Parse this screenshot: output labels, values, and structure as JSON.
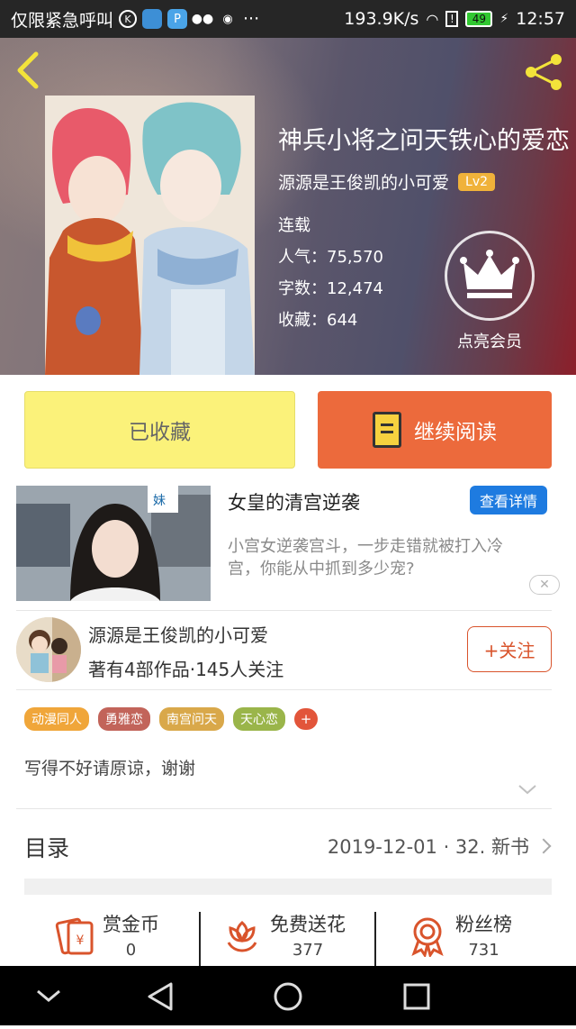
{
  "status_bar": {
    "carrier_text": "仅限紧急呼叫",
    "network_speed": "193.9K/s",
    "battery": "49",
    "time": "12:57",
    "more": "···"
  },
  "book": {
    "title": "神兵小将之问天铁心的爱恋",
    "author": "源源是王俊凯的小可爱",
    "level": "Lv2",
    "status": "连载",
    "popularity": "人气：75,570",
    "word_count": "字数：12,474",
    "favorites": "收藏：644",
    "vip_label": "点亮会员"
  },
  "actions": {
    "collected_label": "已收藏",
    "continue_label": "继续阅读"
  },
  "ad": {
    "title": "女皇的清宫逆袭",
    "detail_button": "查看详情",
    "description": "小宫女逆袭宫斗，一步走错就被打入冷宫，你能从中抓到多少宠?",
    "close": "✕",
    "sign_text": "妹"
  },
  "author_panel": {
    "name": "源源是王俊凯的小可爱",
    "stats": "著有4部作品·145人关注",
    "follow_label": "+关注"
  },
  "tags": [
    {
      "label": "动漫同人",
      "color": "#f0a63a"
    },
    {
      "label": "勇雅恋",
      "color": "#c2645a"
    },
    {
      "label": "南宫问天",
      "color": "#d9a84a"
    },
    {
      "label": "天心恋",
      "color": "#9ab54a"
    }
  ],
  "tag_add": "+",
  "intro": "写得不好请原谅，谢谢",
  "catalog": {
    "label": "目录",
    "info": "2019-12-01 · 32.  新书"
  },
  "bottom_stats": [
    {
      "label": "赏金币",
      "value": "0",
      "icon": "red-envelope-icon"
    },
    {
      "label": "免费送花",
      "value": "377",
      "icon": "flower-icon"
    },
    {
      "label": "粉丝榜",
      "value": "731",
      "icon": "medal-icon"
    }
  ],
  "colors": {
    "accent_orange": "#ec6a3c",
    "collected_yellow": "#fbf27a",
    "icon_red": "#d9542c",
    "back_arrow_yellow": "#f3e33a"
  }
}
